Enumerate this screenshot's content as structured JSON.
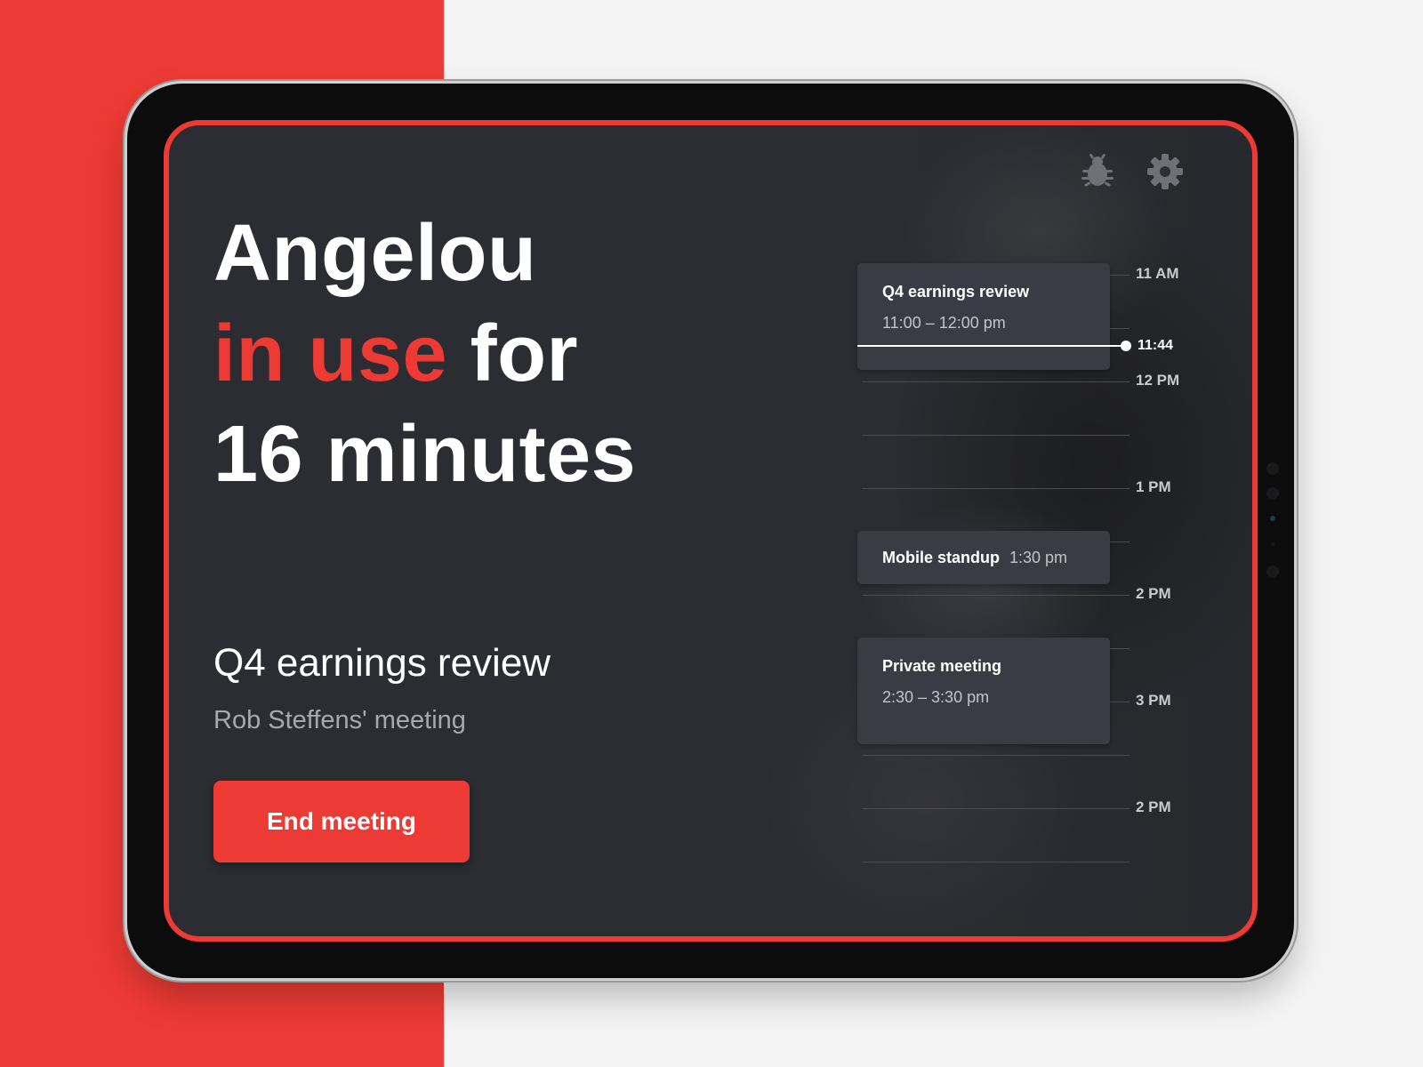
{
  "room": {
    "name": "Angelou",
    "status_highlight": "in use",
    "status_suffix": "for",
    "duration": "16 minutes"
  },
  "current_meeting": {
    "title": "Q4 earnings review",
    "owner": "Rob Steffens' meeting"
  },
  "actions": {
    "end_meeting_label": "End meeting",
    "bug_icon": "bug-icon",
    "settings_icon": "gear-icon"
  },
  "timeline": {
    "hours": [
      "11 AM",
      "12 PM",
      "1 PM",
      "2 PM",
      "3 PM",
      "2 PM"
    ],
    "current_time": "11:44",
    "events": [
      {
        "title": "Q4 earnings review",
        "time": "11:00 – 12:00 pm"
      },
      {
        "title": "Mobile standup",
        "time": "1:30 pm"
      },
      {
        "title": "Private meeting",
        "time": "2:30 – 3:30 pm"
      }
    ]
  },
  "colors": {
    "accent": "#ee3a34",
    "screen_background": "#2b2d32",
    "event_card": "#3a3c45"
  }
}
